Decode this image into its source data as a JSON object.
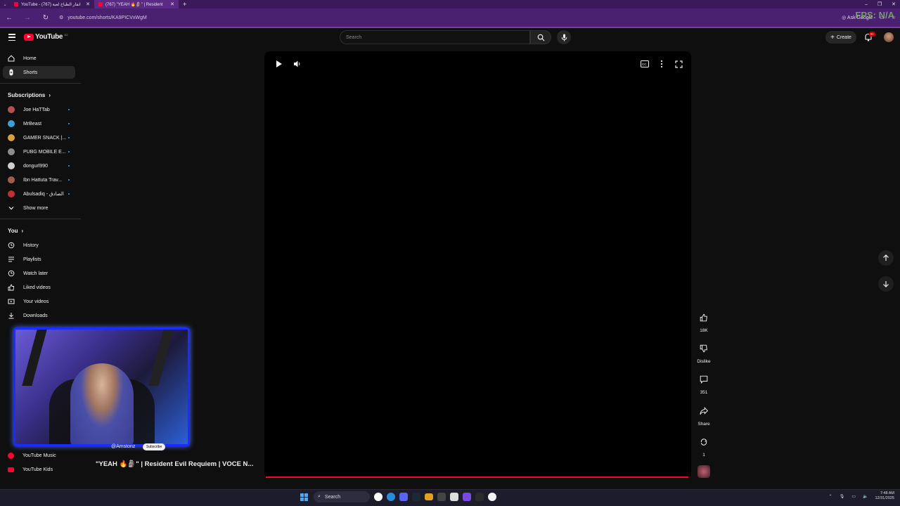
{
  "browser": {
    "tabs": [
      {
        "title": "YouTube - انفار الطباخ لعبة (767)",
        "active": false
      },
      {
        "title": "(767) \"YEAH 🔥🗿\" | Resident",
        "active": true
      }
    ],
    "url": "youtube.com/shorts/KA9PICVxWgM",
    "ask_google": "Ask Google",
    "overlay_text": "FPS: N/A"
  },
  "youtube": {
    "logo_text": "YouTube",
    "logo_sup": "JO",
    "search_placeholder": "Search",
    "create_label": "Create",
    "notif_badge": "9+"
  },
  "sidebar": {
    "main": [
      {
        "label": "Home",
        "icon": "home-icon",
        "selected": false
      },
      {
        "label": "Shorts",
        "icon": "shorts-icon",
        "selected": true
      }
    ],
    "subscriptions_heading": "Subscriptions",
    "subscriptions": [
      {
        "label": "Joe HaTTab",
        "color": "#b45050"
      },
      {
        "label": "MrBeast",
        "color": "#3aa0d8"
      },
      {
        "label": "GAMER SNACK |...",
        "color": "#d8a040"
      },
      {
        "label": "PUBG MOBILE E...",
        "color": "#8c8c8c"
      },
      {
        "label": "dongurl990",
        "color": "#d0d0d0"
      },
      {
        "label": "Ibn Hattuta Trav...",
        "color": "#a06050"
      },
      {
        "label": "Abulsadiq - الصادق",
        "color": "#c03030"
      }
    ],
    "show_more": "Show more",
    "you_heading": "You",
    "you_items": [
      {
        "label": "History",
        "icon": "history-icon"
      },
      {
        "label": "Playlists",
        "icon": "playlists-icon"
      },
      {
        "label": "Watch later",
        "icon": "clock-icon"
      },
      {
        "label": "Liked videos",
        "icon": "thumb-up-icon"
      },
      {
        "label": "Your videos",
        "icon": "your-videos-icon"
      },
      {
        "label": "Downloads",
        "icon": "download-icon"
      }
    ],
    "more_items": [
      {
        "label": "YouTube Music"
      },
      {
        "label": "YouTube Kids"
      }
    ]
  },
  "short": {
    "title": "\"YEAH 🔥🗿\" | Resident Evil Requiem | VOCE N...",
    "channel": "@Amstonz",
    "subscribe": "Subscribe",
    "progress_percent": 100,
    "actions": [
      {
        "name": "like",
        "label": "18K"
      },
      {
        "name": "dislike",
        "label": "Dislike"
      },
      {
        "name": "comments",
        "label": "351"
      },
      {
        "name": "share",
        "label": "Share"
      },
      {
        "name": "remix",
        "label": "1"
      }
    ]
  },
  "taskbar": {
    "search_label": "Search",
    "time": "7:48 AM",
    "date": "12/31/2025"
  }
}
